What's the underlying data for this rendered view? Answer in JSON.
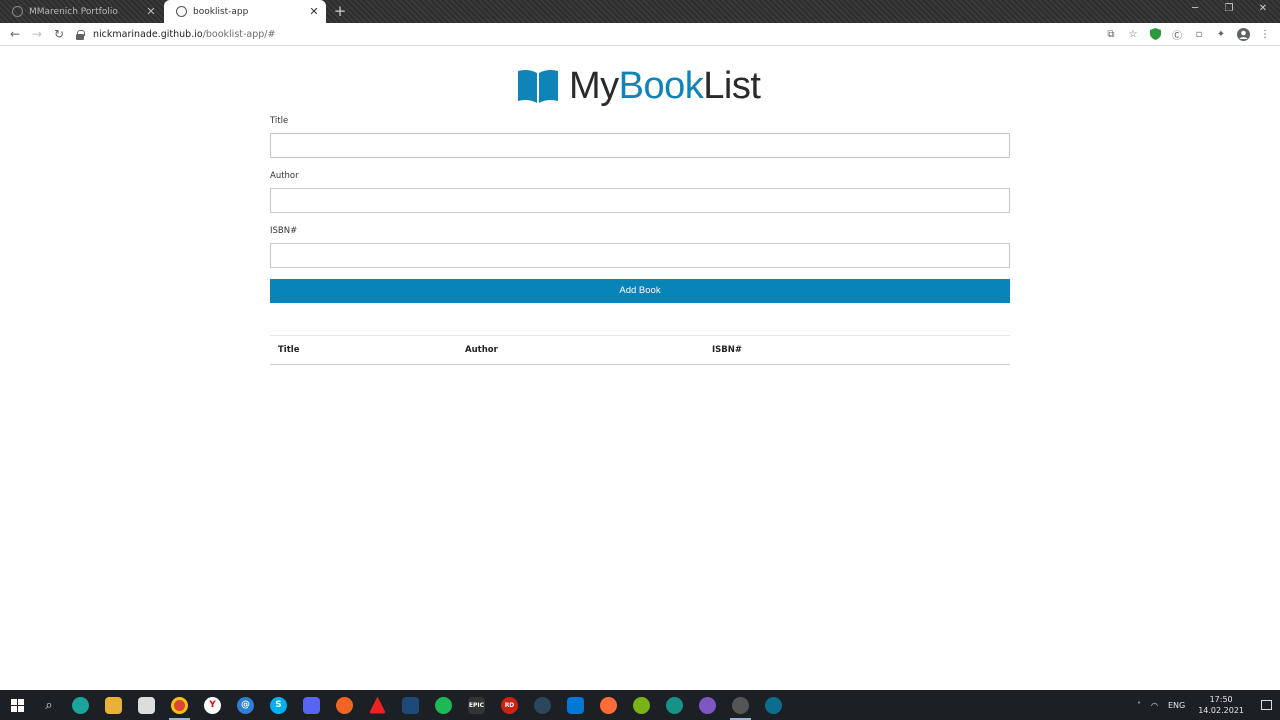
{
  "browser": {
    "tabs": [
      {
        "title": "MMarenich Portfolio",
        "active": false
      },
      {
        "title": "booklist-app",
        "active": true
      }
    ],
    "new_tab": "+",
    "url_host": "nickmarinade.github.io",
    "url_path": "/booklist-app/#"
  },
  "brand": {
    "part1": "My",
    "part2": "Book",
    "part3": "List",
    "accent_color": "#0f84b9"
  },
  "form": {
    "title_label": "Title",
    "title_value": "",
    "author_label": "Author",
    "author_value": "",
    "isbn_label": "ISBN#",
    "isbn_value": "",
    "submit_label": "Add Book"
  },
  "table": {
    "columns": [
      "Title",
      "Author",
      "ISBN#"
    ],
    "rows": []
  },
  "taskbar": {
    "apps": [
      "edge-icon",
      "file-explorer-icon",
      "store-icon",
      "chrome-icon",
      "yandex-icon",
      "at-icon",
      "skype-icon",
      "discord-icon",
      "brave-icon",
      "sourcetree-icon",
      "mountain-icon",
      "spotify-icon",
      "epic-games-icon",
      "rd-icon",
      "steam-icon",
      "vscode-icon",
      "postman-icon",
      "green-app-icon",
      "gitkraken-icon",
      "purple-app-icon",
      "github-desktop-icon",
      "app-icon"
    ],
    "language": "ENG",
    "time": "17:50",
    "date": "14.02.2021"
  }
}
